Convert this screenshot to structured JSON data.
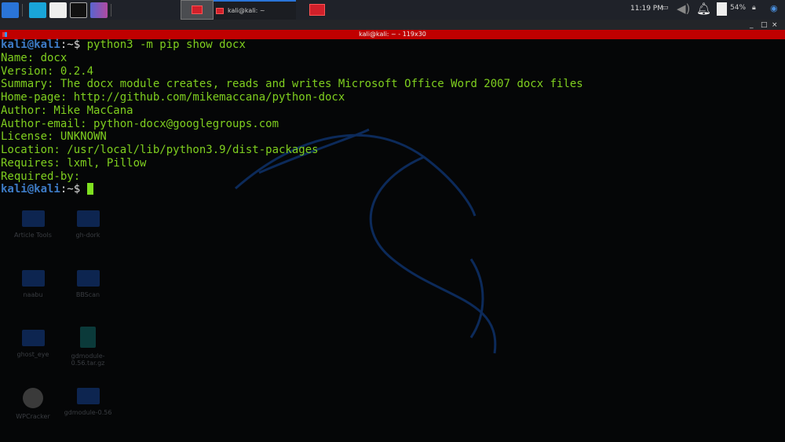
{
  "taskbar": {
    "window_task": "kali@kali: ~",
    "clock": "11:19 PM",
    "battery": "54%"
  },
  "window": {
    "title": "kali@kali: ~ - 119x30",
    "controls": [
      "_",
      "□",
      "×"
    ]
  },
  "terminal": {
    "prompt_user": "kali@kali",
    "prompt_suffix": ":~$ ",
    "command": "python3 -m pip show docx",
    "output": [
      "Name: docx",
      "Version: 0.2.4",
      "Summary: The docx module creates, reads and writes Microsoft Office Word 2007 docx files",
      "Home-page: http://github.com/mikemaccana/python-docx",
      "Author: Mike MacCana",
      "Author-email: python-docx@googlegroups.com",
      "License: UNKNOWN",
      "Location: /usr/local/lib/python3.9/dist-packages",
      "Requires: lxml, Pillow",
      "Required-by:"
    ]
  },
  "desktop": {
    "icons": [
      "Article Tools",
      "gh-dork",
      "naabu",
      "BBScan",
      "ghost_eye",
      "gdmodule-0.56.tar.gz",
      "WPCracker",
      "gdmodule-0.56"
    ]
  },
  "colors": {
    "accent": "#c00000",
    "prompt": "#3d7bc6",
    "text": "#7fcf1f"
  }
}
